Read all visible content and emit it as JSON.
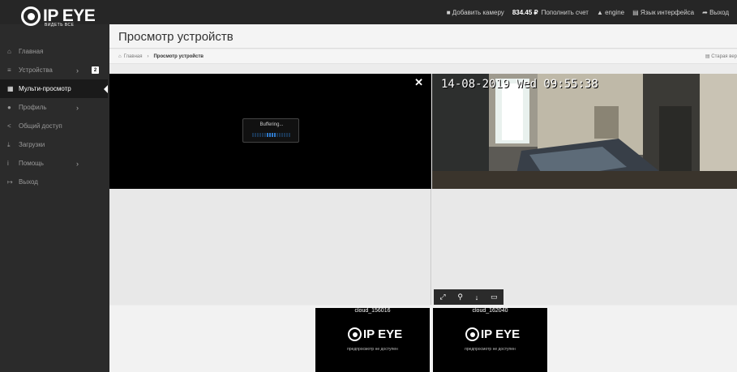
{
  "logo": {
    "text": "IP EYE",
    "subtitle": "ВИДЕТЬ ВСЕ"
  },
  "topnav": {
    "add_camera": "Добавить камеру",
    "balance": "834.45 ₽",
    "top_up": "Пополнить счет",
    "user": "engine",
    "language": "Язык интерфейса",
    "logout": "Выход"
  },
  "sidebar": {
    "items": [
      {
        "icon": "home-icon",
        "glyph": "⌂",
        "label": "Главная"
      },
      {
        "icon": "list-icon",
        "glyph": "≡",
        "label": "Устройства",
        "badge": "2"
      },
      {
        "icon": "grid-icon",
        "glyph": "▦",
        "label": "Мульти-просмотр",
        "active": true
      },
      {
        "icon": "user-icon",
        "glyph": "●",
        "label": "Профиль"
      },
      {
        "icon": "share-icon",
        "glyph": "<",
        "label": "Общий доступ"
      },
      {
        "icon": "download-icon",
        "glyph": "⤓",
        "label": "Загрузки"
      },
      {
        "icon": "info-icon",
        "glyph": "i",
        "label": "Помощь"
      },
      {
        "icon": "exit-icon",
        "glyph": "↦",
        "label": "Выход"
      }
    ]
  },
  "page": {
    "title": "Просмотр устройств"
  },
  "breadcrumb": {
    "home": "Главная",
    "current": "Просмотр устройств",
    "old": "Старая вер"
  },
  "viewer": {
    "buffering": "Buffering...",
    "buffer_progress": 0.65,
    "osd": "14-08-2019 Wed 09:55:38"
  },
  "thumbs": [
    {
      "title": "cloud_156016",
      "note": "предпросмотр не доступен"
    },
    {
      "title": "cloud_162040",
      "note": "предпросмотр не доступен"
    }
  ],
  "colors": {
    "sidebar": "#2b2b2b",
    "accent": "#2e78c9"
  }
}
